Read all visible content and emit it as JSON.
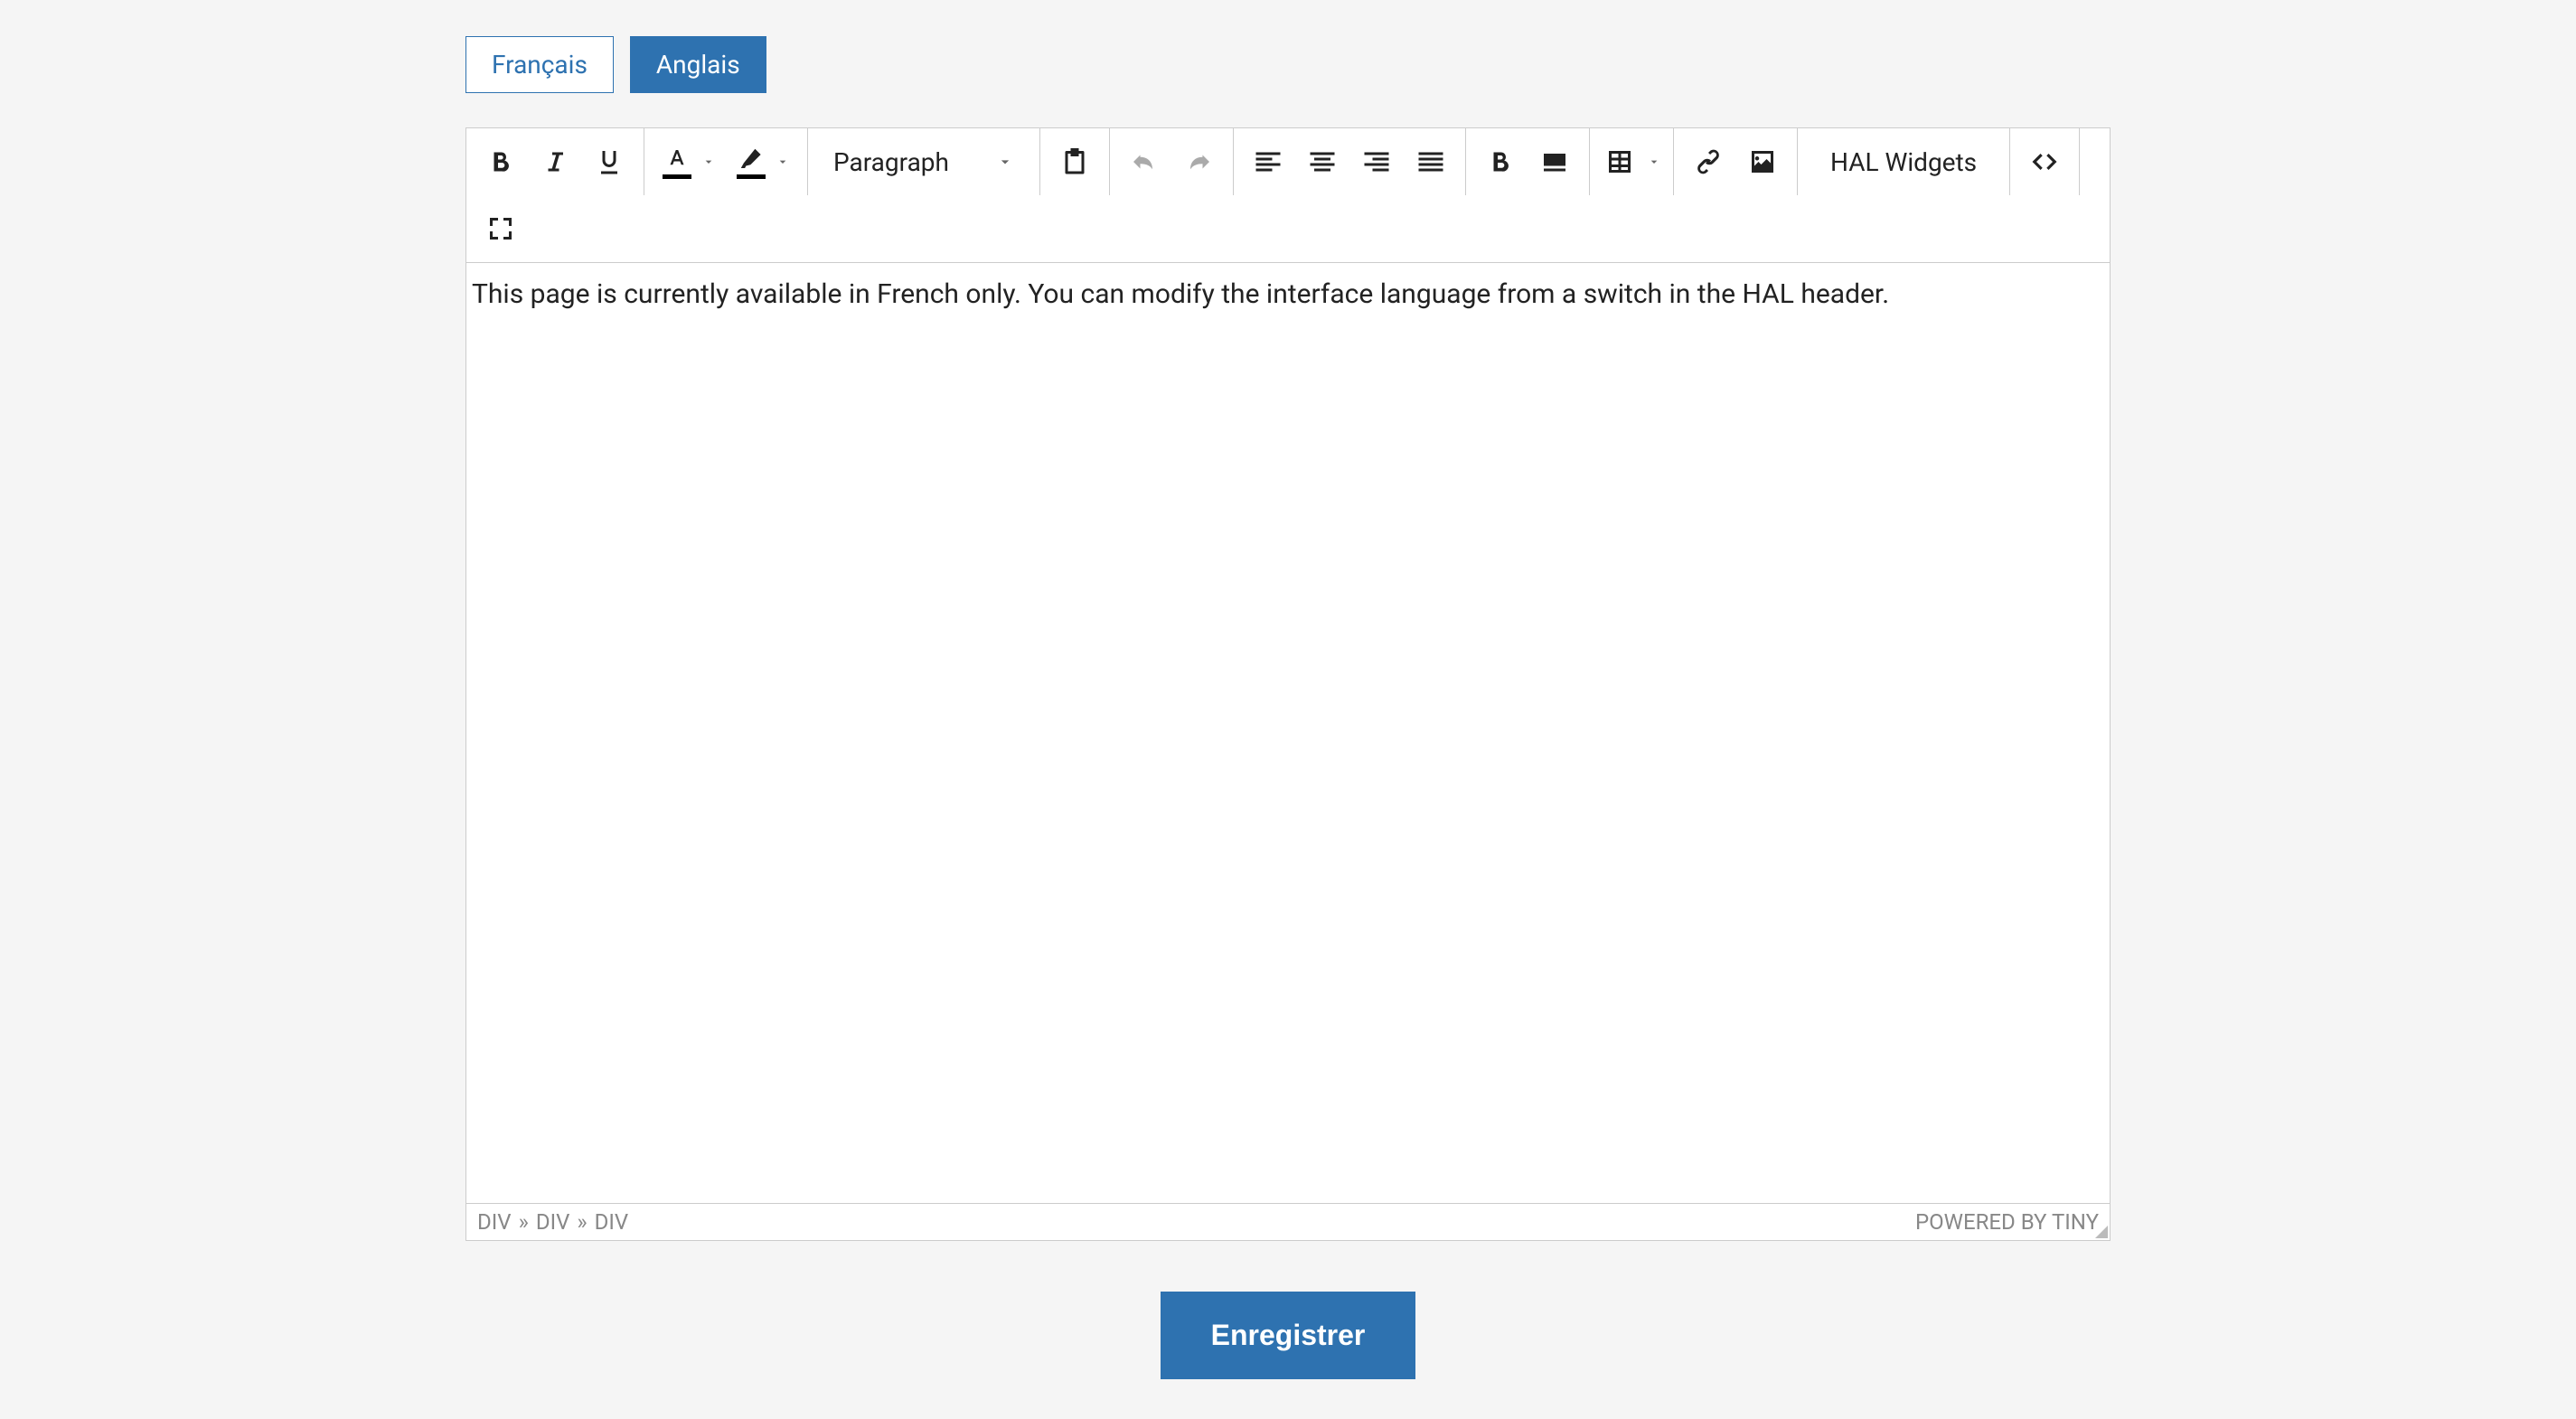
{
  "tabs": [
    {
      "label": "Français"
    },
    {
      "label": "Anglais"
    }
  ],
  "toolbar": {
    "format_select": "Paragraph",
    "widgets_label": "HAL Widgets"
  },
  "content": "This page is currently available in French only. You can modify the interface language from a switch in the HAL header.",
  "footer": {
    "breadcrumb": [
      "DIV",
      "»",
      "DIV",
      "»",
      "DIV"
    ],
    "powered": "POWERED BY TINY"
  },
  "save_label": "Enregistrer"
}
